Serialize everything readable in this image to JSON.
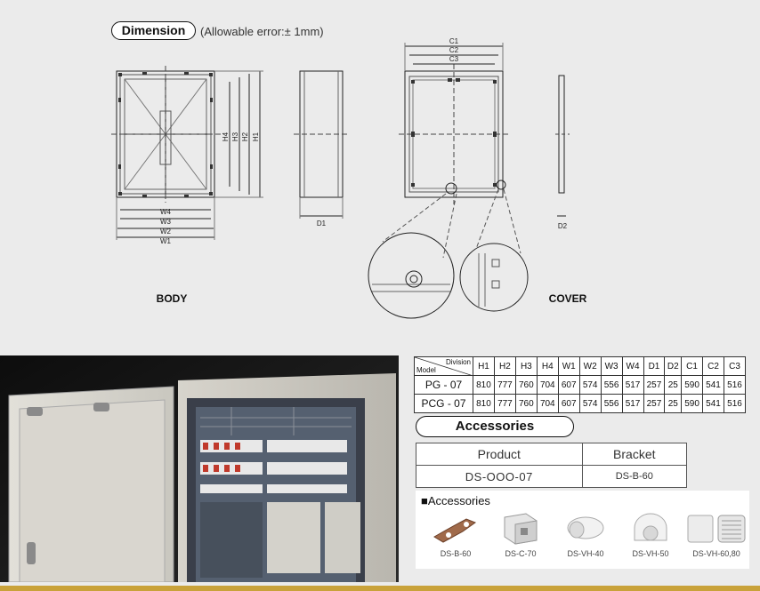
{
  "header": {
    "pill": "Dimension",
    "note": "(Allowable error:± 1mm)"
  },
  "drawing": {
    "body_label": "BODY",
    "cover_label": "COVER",
    "dims": {
      "w4": "W4",
      "w3": "W3",
      "w2": "W2",
      "w1": "W1",
      "h4": "H4",
      "h3": "H3",
      "h2": "H2",
      "h1": "H1",
      "d1": "D1",
      "c1": "C1",
      "c2": "C2",
      "c3": "C3",
      "d2": "D2"
    }
  },
  "spec_table": {
    "corner_top": "Division",
    "corner_bottom": "Model",
    "headers": [
      "H1",
      "H2",
      "H3",
      "H4",
      "W1",
      "W2",
      "W3",
      "W4",
      "D1",
      "D2",
      "C1",
      "C2",
      "C3"
    ],
    "rows": [
      {
        "model": "PG - 07",
        "values": [
          "810",
          "777",
          "760",
          "704",
          "607",
          "574",
          "556",
          "517",
          "257",
          "25",
          "590",
          "541",
          "516"
        ]
      },
      {
        "model": "PCG - 07",
        "values": [
          "810",
          "777",
          "760",
          "704",
          "607",
          "574",
          "556",
          "517",
          "257",
          "25",
          "590",
          "541",
          "516"
        ]
      }
    ]
  },
  "accessories_section": {
    "pill": "Accessories",
    "product_header": "Product",
    "bracket_header": "Bracket",
    "product_value": "DS-OOO-07",
    "bracket_value": "DS-B-60"
  },
  "accessories_panel": {
    "title": "■Accessories",
    "items": [
      {
        "label": "DS-B-60",
        "icon": "bracket-icon"
      },
      {
        "label": "DS-C-70",
        "icon": "wall-bracket-icon"
      },
      {
        "label": "DS-VH-40",
        "icon": "vent-hood-icon"
      },
      {
        "label": "DS-VH-50",
        "icon": "round-vent-hood-icon"
      },
      {
        "label": "DS-VH-60,80",
        "icon": "louver-vent-icon"
      }
    ]
  }
}
